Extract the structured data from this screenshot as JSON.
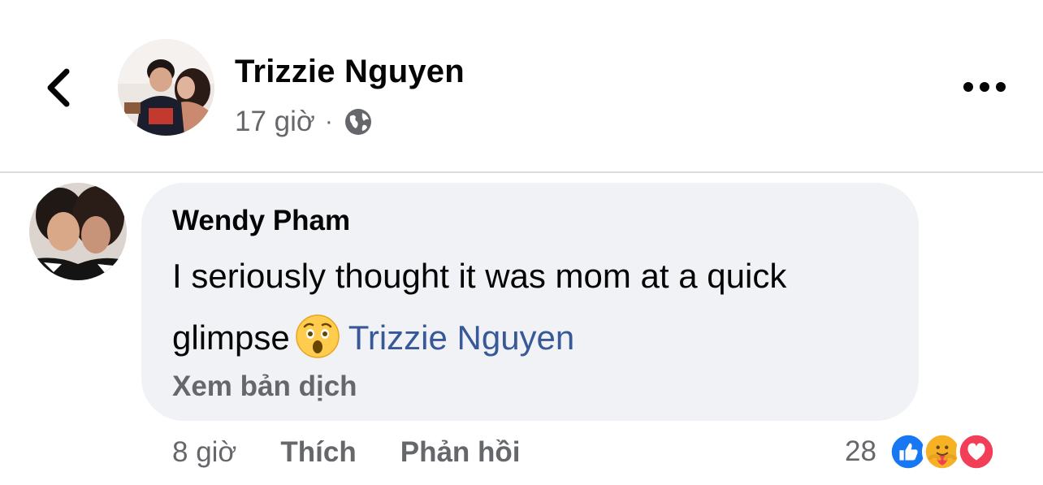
{
  "header": {
    "author_name": "Trizzie Nguyen",
    "post_time": "17 giờ",
    "separator": "·",
    "privacy_icon": "globe-icon",
    "back_icon": "chevron-left-icon",
    "more_icon": "more-horizontal-icon"
  },
  "comment": {
    "author": "Wendy Pham",
    "text_line1": "I seriously thought it was mom at a quick",
    "text_line2": "glimpse",
    "emoji": "hushed-face-emoji",
    "mention": "Trizzie Nguyen",
    "translate_label": "Xem bản dịch",
    "time": "8 giờ",
    "like_label": "Thích",
    "reply_label": "Phản hồi",
    "reaction_count": "28",
    "reaction_icons": [
      "like-icon",
      "care-icon",
      "love-icon"
    ]
  },
  "colors": {
    "bubble_bg": "#f0f2f5",
    "secondary_text": "#65676b",
    "mention": "#385898",
    "like_blue": "#1877f2",
    "love_red": "#f33e58",
    "care_yellow": "#f7b125"
  }
}
